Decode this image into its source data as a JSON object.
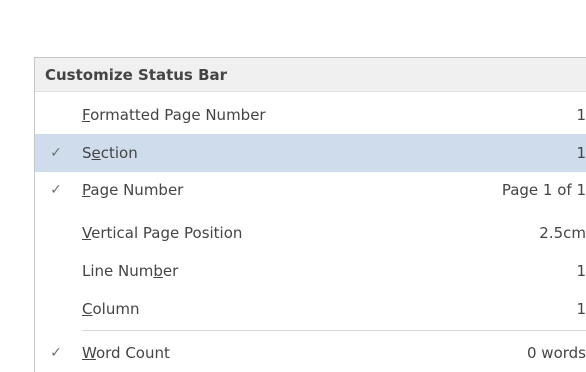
{
  "menu": {
    "title": "Customize Status Bar",
    "items": [
      {
        "pre": "",
        "acc": "F",
        "post": "ormatted Page Number",
        "value": "1",
        "checked": false,
        "highlight": false
      },
      {
        "pre": "S",
        "acc": "e",
        "post": "ction",
        "value": "1",
        "checked": true,
        "highlight": true
      },
      {
        "pre": "",
        "acc": "P",
        "post": "age Number",
        "value": "Page 1 of 1",
        "checked": true,
        "highlight": false
      },
      {
        "pre": "",
        "acc": "V",
        "post": "ertical Page Position",
        "value": "2.5cm",
        "checked": false,
        "highlight": false
      },
      {
        "pre": "Line Num",
        "acc": "b",
        "post": "er",
        "value": "1",
        "checked": false,
        "highlight": false
      },
      {
        "pre": "",
        "acc": "C",
        "post": "olumn",
        "value": "1",
        "checked": false,
        "highlight": false
      },
      {
        "pre": "",
        "acc": "W",
        "post": "ord Count",
        "value": "0 words",
        "checked": true,
        "highlight": false
      }
    ],
    "check_glyph": "✓",
    "icons": {
      "check": "check-mark-icon"
    },
    "colors": {
      "highlight": "#cfdcec",
      "header_bg": "#f0f0f0",
      "text": "#444444"
    }
  }
}
